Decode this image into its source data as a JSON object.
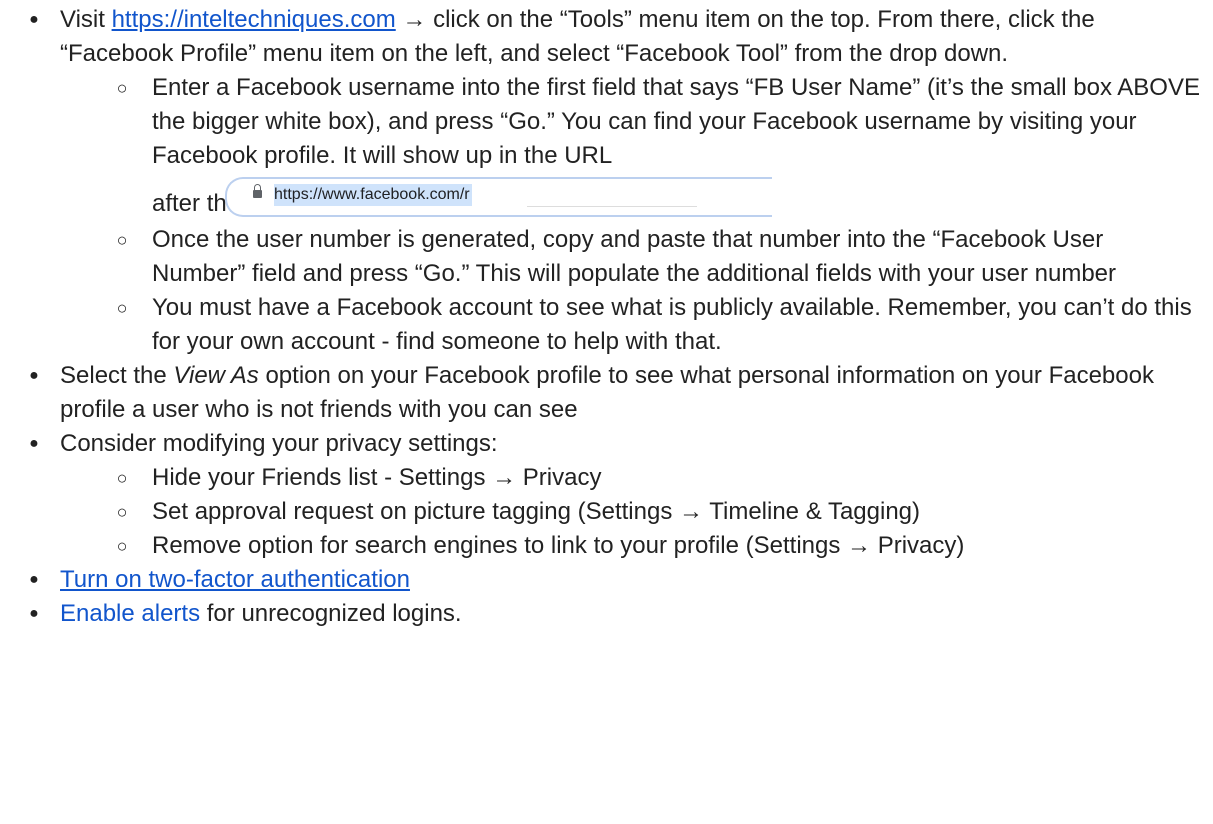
{
  "item1": {
    "prefix": "Visit ",
    "link_text": "https://inteltechniques.com",
    "suffix": " → click on the “Tools” menu item on the top. From there, click the “Facebook Profile” menu item on the left, and select “Facebook Tool” from the drop down."
  },
  "sub1": {
    "text": "Enter a Facebook username into the first field that says “FB User Name” (it’s the small box ABOVE the bigger white box), and press “Go.” You can find your Facebook username by visiting your Facebook profile. It will show up in the URL",
    "after_text": "after the “/”:",
    "url_text": "https://www.facebook.com/r"
  },
  "sub2": {
    "text": "Once the user number is generated, copy and paste that number into the “Facebook User Number” field and press “Go.” This will populate the additional fields with your user number"
  },
  "sub3": {
    "text": "You must have a Facebook account to see what is publicly available. Remember, you can’t do this for your own account - find someone to help with that."
  },
  "item2": {
    "prefix": "Select the ",
    "emphasis": "View As",
    "suffix": " option on your Facebook profile to see what personal information on your Facebook profile a user who is not friends with you can see"
  },
  "item3": {
    "text": "Consider modifying your privacy settings:"
  },
  "sub4": {
    "text": "Hide your Friends list - Settings → Privacy"
  },
  "sub5": {
    "text": "Set approval request on picture tagging (Settings → Timeline & Tagging)"
  },
  "sub6": {
    "text": "Remove option for search engines to link to your profile (Settings → Privacy)"
  },
  "item4": {
    "link_text": "Turn on two-factor authentication"
  },
  "item5": {
    "link_text": "Enable alerts",
    "suffix": " for unrecognized logins."
  },
  "bullets": {
    "level1": "●",
    "level2": "○"
  },
  "colors": {
    "text": "#222222",
    "link": "#1155cc",
    "url_highlight": "#cfe3fb"
  }
}
